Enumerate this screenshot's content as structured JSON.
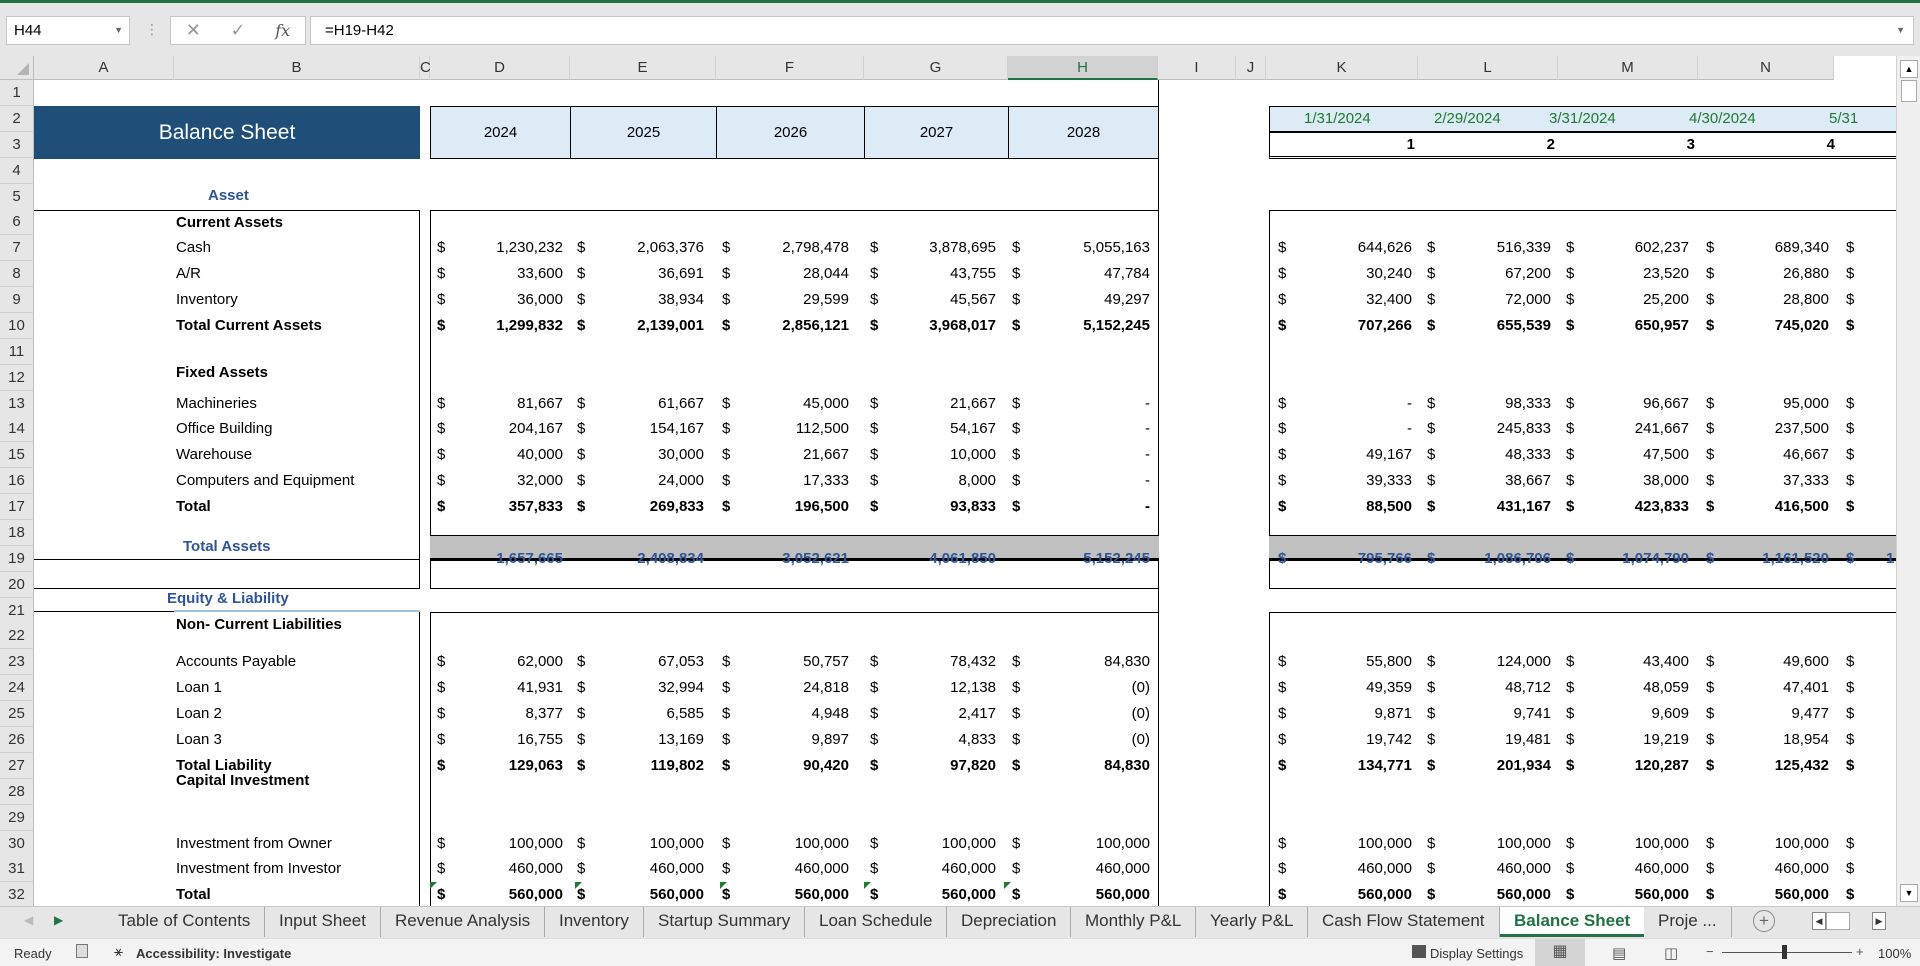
{
  "app": {
    "accent_color": "#217346"
  },
  "formula_bar": {
    "name_box": "H44",
    "formula": "=H19-H42",
    "fx_label": "fx",
    "cancel_icon": "✕",
    "enter_icon": "✓"
  },
  "columns": [
    "A",
    "B",
    "C",
    "D",
    "E",
    "F",
    "G",
    "H",
    "I",
    "J",
    "K",
    "L",
    "M",
    "N"
  ],
  "selected_column": "H",
  "rows": [
    "1",
    "2",
    "3",
    "4",
    "5",
    "6",
    "7",
    "8",
    "9",
    "10",
    "11",
    "12",
    "13",
    "14",
    "15",
    "16",
    "17",
    "18",
    "19",
    "20",
    "21",
    "22",
    "23",
    "24",
    "25",
    "26",
    "27",
    "28",
    "29",
    "30",
    "31",
    "32"
  ],
  "sheet": {
    "title": "Balance Sheet",
    "years": [
      "2024",
      "2025",
      "2026",
      "2027",
      "2028"
    ],
    "months": [
      "1/31/2024",
      "2/29/2024",
      "3/31/2024",
      "4/30/2024",
      "5/31"
    ],
    "month_numbers": [
      "1",
      "2",
      "3",
      "4"
    ],
    "currency": "$",
    "asset_heading": "Asset",
    "current_assets_heading": "Current Assets",
    "fixed_assets_heading": "Fixed Assets",
    "total_assets_label": "Total Assets",
    "equity_heading": "Equity & Liability",
    "ncl_heading": "Non- Current Liabilities",
    "capital_heading": "Capital Investment",
    "lines": [
      {
        "row": 7,
        "label": "Cash",
        "bold": false,
        "yearly": [
          "1,230,232",
          "2,063,376",
          "2,798,478",
          "3,878,695",
          "5,055,163"
        ],
        "monthly": [
          "644,626",
          "516,339",
          "602,237",
          "689,340"
        ]
      },
      {
        "row": 8,
        "label": "A/R",
        "bold": false,
        "yearly": [
          "33,600",
          "36,691",
          "28,044",
          "43,755",
          "47,784"
        ],
        "monthly": [
          "30,240",
          "67,200",
          "23,520",
          "26,880"
        ]
      },
      {
        "row": 9,
        "label": "Inventory",
        "bold": false,
        "yearly": [
          "36,000",
          "38,934",
          "29,599",
          "45,567",
          "49,297"
        ],
        "monthly": [
          "32,400",
          "72,000",
          "25,200",
          "28,800"
        ]
      },
      {
        "row": 10,
        "label": "Total Current Assets",
        "bold": true,
        "yearly": [
          "1,299,832",
          "2,139,001",
          "2,856,121",
          "3,968,017",
          "5,152,245"
        ],
        "monthly": [
          "707,266",
          "655,539",
          "650,957",
          "745,020"
        ]
      },
      {
        "row": 13,
        "label": "Machineries",
        "bold": false,
        "yearly": [
          "81,667",
          "61,667",
          "45,000",
          "21,667",
          "-"
        ],
        "monthly": [
          "-",
          "98,333",
          "96,667",
          "95,000"
        ]
      },
      {
        "row": 14,
        "label": "Office Building",
        "bold": false,
        "yearly": [
          "204,167",
          "154,167",
          "112,500",
          "54,167",
          "-"
        ],
        "monthly": [
          "-",
          "245,833",
          "241,667",
          "237,500"
        ]
      },
      {
        "row": 15,
        "label": "Warehouse",
        "bold": false,
        "yearly": [
          "40,000",
          "30,000",
          "21,667",
          "10,000",
          "-"
        ],
        "monthly": [
          "49,167",
          "48,333",
          "47,500",
          "46,667"
        ]
      },
      {
        "row": 16,
        "label": "Computers and Equipment",
        "bold": false,
        "yearly": [
          "32,000",
          "24,000",
          "17,333",
          "8,000",
          "-"
        ],
        "monthly": [
          "39,333",
          "38,667",
          "38,000",
          "37,333"
        ]
      },
      {
        "row": 17,
        "label": "Total",
        "bold": true,
        "yearly": [
          "357,833",
          "269,833",
          "196,500",
          "93,833",
          "-"
        ],
        "monthly": [
          "88,500",
          "431,167",
          "423,833",
          "416,500"
        ]
      },
      {
        "row": 23,
        "label": " Accounts Payable",
        "bold": false,
        "yearly": [
          "62,000",
          "67,053",
          "50,757",
          "78,432",
          "84,830"
        ],
        "monthly": [
          "55,800",
          "124,000",
          "43,400",
          "49,600"
        ]
      },
      {
        "row": 24,
        "label": "Loan 1",
        "bold": false,
        "yearly": [
          "41,931",
          "32,994",
          "24,818",
          "12,138",
          "(0)"
        ],
        "monthly": [
          "49,359",
          "48,712",
          "48,059",
          "47,401"
        ]
      },
      {
        "row": 25,
        "label": "Loan 2",
        "bold": false,
        "yearly": [
          "8,377",
          "6,585",
          "4,948",
          "2,417",
          "(0)"
        ],
        "monthly": [
          "9,871",
          "9,741",
          "9,609",
          "9,477"
        ]
      },
      {
        "row": 26,
        "label": "Loan 3",
        "bold": false,
        "yearly": [
          "16,755",
          "13,169",
          "9,897",
          "4,833",
          "(0)"
        ],
        "monthly": [
          "19,742",
          "19,481",
          "19,219",
          "18,954"
        ]
      },
      {
        "row": 27,
        "label": "Total Liability",
        "bold": true,
        "yearly": [
          "129,063",
          "119,802",
          "90,420",
          "97,820",
          "84,830"
        ],
        "monthly": [
          "134,771",
          "201,934",
          "120,287",
          "125,432"
        ]
      },
      {
        "row": 30,
        "label": "Investment from Owner",
        "bold": false,
        "yearly": [
          "100,000",
          "100,000",
          "100,000",
          "100,000",
          "100,000"
        ],
        "monthly": [
          "100,000",
          "100,000",
          "100,000",
          "100,000"
        ]
      },
      {
        "row": 31,
        "label": "Investment from Investor",
        "bold": false,
        "yearly": [
          "460,000",
          "460,000",
          "460,000",
          "460,000",
          "460,000"
        ],
        "monthly": [
          "460,000",
          "460,000",
          "460,000",
          "460,000"
        ]
      },
      {
        "row": 32,
        "label": "Total",
        "bold": true,
        "yearly": [
          "560,000",
          "560,000",
          "560,000",
          "560,000",
          "560,000"
        ],
        "monthly": [
          "560,000",
          "560,000",
          "560,000",
          "560,000"
        ]
      }
    ],
    "total_assets": {
      "yearly": [
        "1,657,665",
        "2,408,834",
        "3,052,621",
        "4,061,850",
        "5,152,245"
      ],
      "monthly": [
        "795,766",
        "1,086,706",
        "1,074,790",
        "1,161,520"
      ],
      "monthly_partial": "1"
    }
  },
  "tabs": [
    "Table of Contents",
    "Input Sheet",
    "Revenue Analysis",
    "Inventory",
    "Startup Summary",
    "Loan Schedule",
    "Depreciation",
    "Monthly P&L",
    "Yearly P&L",
    "Cash Flow Statement",
    "Balance Sheet",
    "Proje ..."
  ],
  "active_tab": "Balance Sheet",
  "status": {
    "ready": "Ready",
    "accessibility": "Accessibility: Investigate",
    "display_settings": "Display Settings",
    "zoom": "100%"
  }
}
